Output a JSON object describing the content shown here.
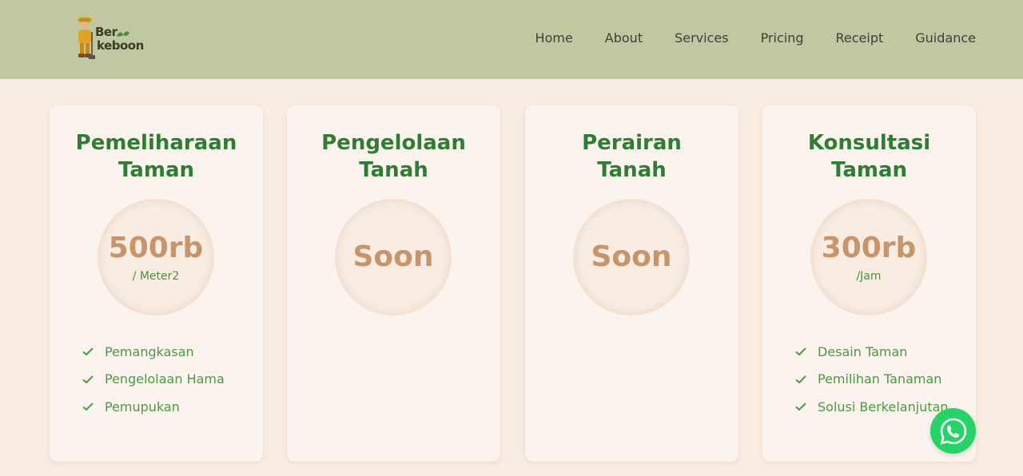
{
  "header": {
    "logo": {
      "text_line1": "Ber",
      "text_line2": "keboon",
      "icon": "farmer-mascot-icon"
    },
    "nav": [
      "Home",
      "About",
      "Services",
      "Pricing",
      "Receipt",
      "Guidance"
    ]
  },
  "pricing": {
    "cards": [
      {
        "title_line1": "Pemeliharaan",
        "title_line2": "Taman",
        "price": "500rb",
        "unit": "/ Meter2",
        "features": [
          "Pemangkasan",
          "Pengelolaan Hama",
          "Pemupukan"
        ]
      },
      {
        "title_line1": "Pengelolaan",
        "title_line2": "Tanah",
        "price": "Soon",
        "unit": "",
        "features": []
      },
      {
        "title_line1": "Perairan",
        "title_line2": "Tanah",
        "price": "Soon",
        "unit": "",
        "features": []
      },
      {
        "title_line1": "Konsultasi",
        "title_line2": "Taman",
        "price": "300rb",
        "unit": "/Jam",
        "features": [
          "Desain Taman",
          "Pemilihan Tanaman",
          "Solusi Berkelanjutan"
        ]
      }
    ]
  },
  "whatsapp": {
    "icon": "whatsapp-icon"
  },
  "colors": {
    "header_bg": "#bfc8a0",
    "page_bg": "#f8ece3",
    "card_bg": "#faf3ee",
    "title_green": "#2e7d32",
    "price_tan": "#c8956a",
    "feature_green": "#4a9b3f",
    "whatsapp_green": "#25d366"
  }
}
